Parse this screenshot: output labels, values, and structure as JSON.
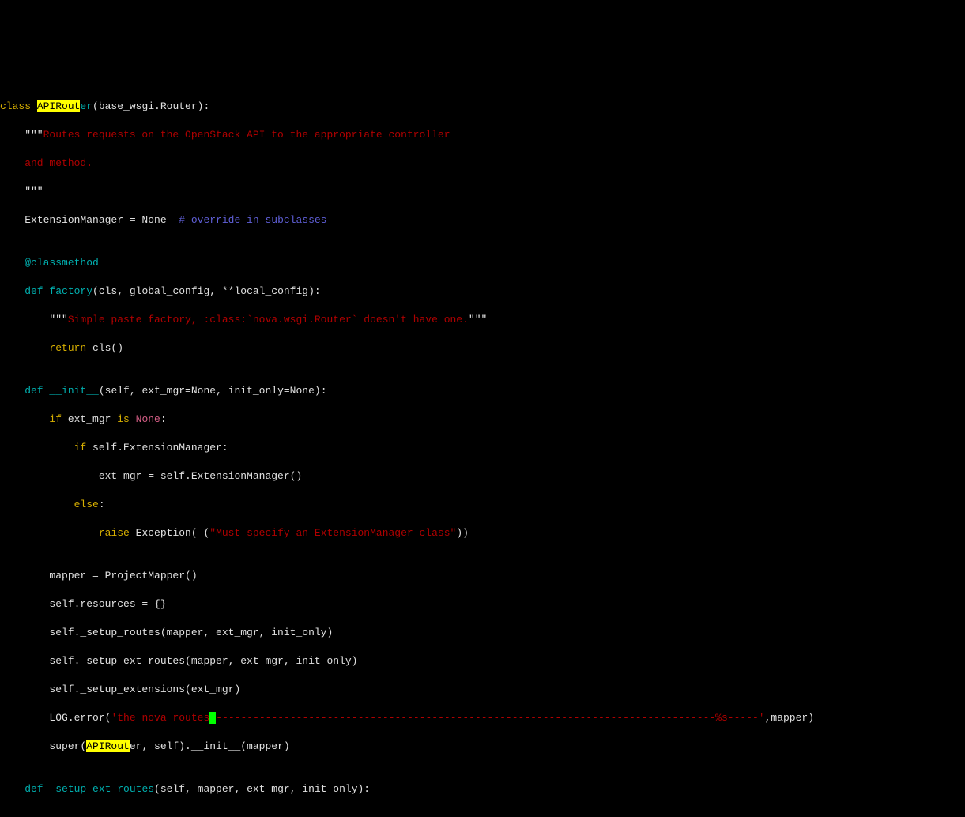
{
  "code": {
    "l01_class": "class ",
    "l01_hl": "APIRout",
    "l01_after_hl": "er",
    "l01_paren": "(base_wsgi.Router):",
    "l02_q": "    \"\"\"",
    "l02_doc": "Routes requests on the OpenStack API to the appropriate controller",
    "l03_doc": "    and method.",
    "l04_q": "    \"\"\"",
    "l05_a": "    ExtensionManager = None",
    "l05_comment": "  # override in subclasses",
    "l06": "",
    "l07_dec": "    @classmethod",
    "l08_def": "    def ",
    "l08_fn": "factory",
    "l08_sig": "(cls, global_config, **local_config):",
    "l09_q1": "        \"\"\"",
    "l09_doc": "Simple paste factory, :class:`nova.wsgi.Router` doesn't have one.",
    "l09_q2": "\"\"\"",
    "l10_ret": "        return ",
    "l10_rest": "cls()",
    "l11": "",
    "l12_def": "    def ",
    "l12_fn": "__init__",
    "l12_sig": "(self, ext_mgr=None, init_only=None):",
    "l13_if": "        if ",
    "l13_rest": "ext_mgr ",
    "l13_is": "is ",
    "l13_none": "None",
    "l13_colon": ":",
    "l14_if": "            if ",
    "l14_rest": "self.ExtensionManager:",
    "l15": "                ext_mgr = self.ExtensionManager()",
    "l16_else": "            else",
    "l16_colon": ":",
    "l17_raise": "                raise ",
    "l17_exc": "Exception(_(",
    "l17_str": "\"Must specify an ExtensionManager class\"",
    "l17_close": "))",
    "l18": "",
    "l19": "        mapper = ProjectMapper()",
    "l20": "        self.resources = {}",
    "l21": "        self._setup_routes(mapper, ext_mgr, init_only)",
    "l22": "        self._setup_ext_routes(mapper, ext_mgr, init_only)",
    "l23": "        self._setup_extensions(ext_mgr)",
    "l24_a": "        LOG.error(",
    "l24_str1": "'the nova routes",
    "l24_dashes": "---------------------------------------------------------------------------------%s-----'",
    "l24_end": ",mapper)",
    "l25_a": "        super(",
    "l25_hl": "APIRout",
    "l25_after_hl": "er",
    "l25_rest": ", self).__init__(mapper)",
    "l26": "",
    "l27_def": "    def ",
    "l27_fn": "_setup_ext_routes",
    "l27_sig": "(self, mapper, ext_mgr, init_only):"
  }
}
